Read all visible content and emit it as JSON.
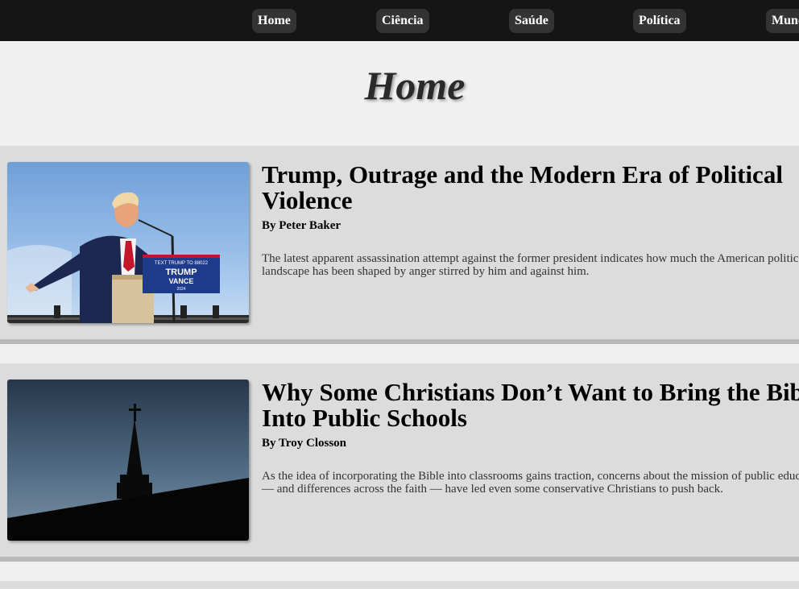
{
  "nav": {
    "items": [
      {
        "label": "Home"
      },
      {
        "label": "Ciência"
      },
      {
        "label": "Saúde"
      },
      {
        "label": "Política"
      },
      {
        "label": "Mundo"
      }
    ]
  },
  "page": {
    "title": "Home"
  },
  "articles": [
    {
      "headline": "Trump, Outrage and the Modern Era of Political Violence",
      "byline": "By Peter Baker",
      "summary": "The latest apparent assassination attempt against the former president indicates how much the American political landscape has been shaped by anger stirred by him and against him.",
      "image": {
        "sign_line1": "TEXT TRUMP TO 88022",
        "sign_line2": "TRUMP",
        "sign_line3": "VANCE",
        "sign_line4": "2024"
      }
    },
    {
      "headline": "Why Some Christians Don’t Want to Bring the Bible Into Public Schools",
      "byline": "By Troy Closson",
      "summary": "As the idea of incorporating the Bible into classrooms gains traction, concerns about the mission of public education — and differences across the faith — have led even some conservative Christians to push back."
    }
  ]
}
